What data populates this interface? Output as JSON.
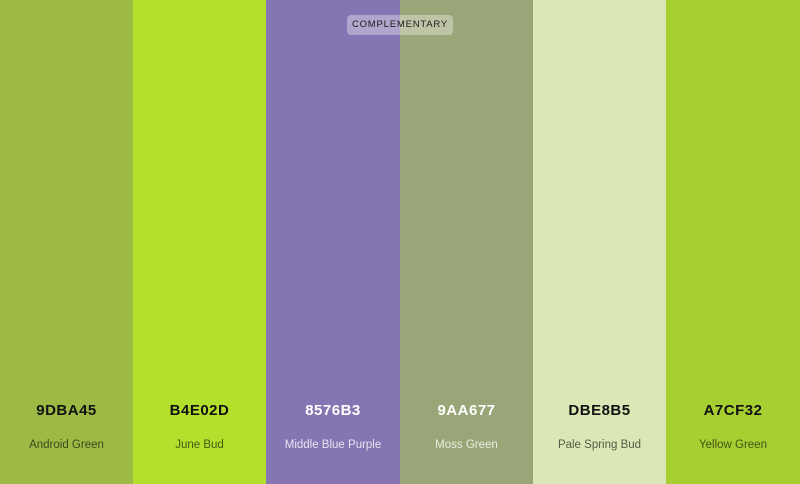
{
  "scheme_label": "COMPLEMENTARY",
  "swatches": [
    {
      "hex": "9DBA45",
      "name": "Android Green",
      "color": "#9DBA45",
      "text_theme": "dark"
    },
    {
      "hex": "B4E02D",
      "name": "June Bud",
      "color": "#B4E02D",
      "text_theme": "dark"
    },
    {
      "hex": "8576B3",
      "name": "Middle Blue Purple",
      "color": "#8576B3",
      "text_theme": "light"
    },
    {
      "hex": "9AA677",
      "name": "Moss Green",
      "color": "#9AA677",
      "text_theme": "light"
    },
    {
      "hex": "DBE8B5",
      "name": "Pale Spring Bud",
      "color": "#DBE8B5",
      "text_theme": "dark"
    },
    {
      "hex": "A7CF32",
      "name": "Yellow Green",
      "color": "#A7CF32",
      "text_theme": "dark"
    }
  ]
}
